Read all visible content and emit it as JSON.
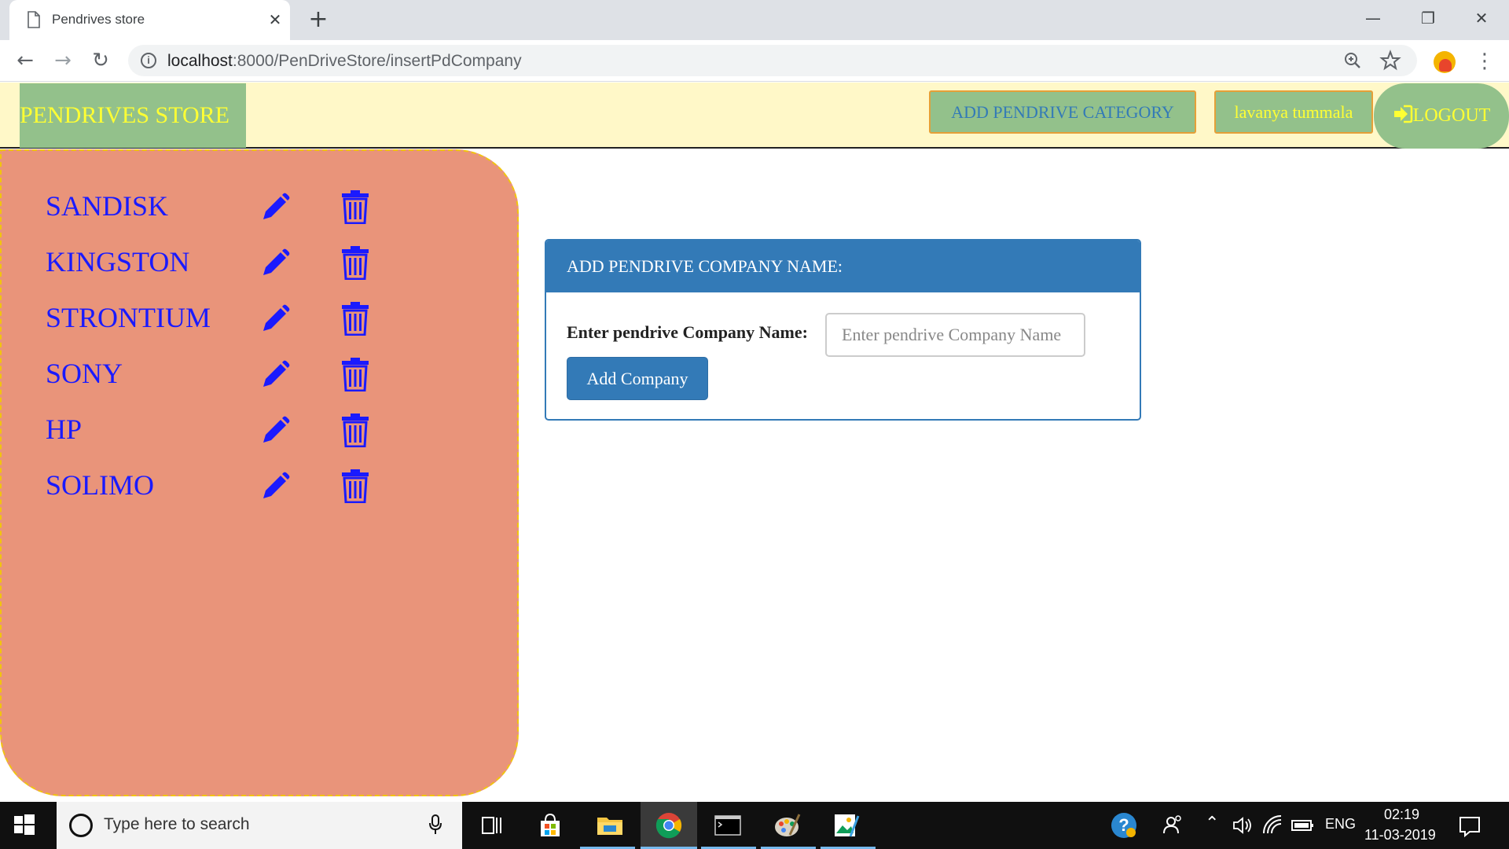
{
  "browser": {
    "tab_title": "Pendrives store",
    "tab_close": "✕",
    "new_tab": "+",
    "url_host": "localhost",
    "url_path": ":8000/PenDriveStore/insertPdCompany",
    "window_controls": {
      "minimize": "—",
      "restore": "❐",
      "close": "✕"
    },
    "nav": {
      "back": "←",
      "forward": "→",
      "reload": "↻"
    },
    "icons": [
      "document-icon",
      "info-icon",
      "zoom-icon",
      "star-icon",
      "profile-avatar",
      "menu-icon"
    ]
  },
  "header": {
    "brand": "PENDRIVES STORE",
    "add_category": "ADD PENDRIVE CATEGORY",
    "user_name": "lavanya tummala",
    "logout": "LOGOUT"
  },
  "sidebar": {
    "companies": [
      {
        "name": "SANDISK"
      },
      {
        "name": "KINGSTON"
      },
      {
        "name": "STRONTIUM"
      },
      {
        "name": "SONY"
      },
      {
        "name": "HP"
      },
      {
        "name": "SOLIMO"
      }
    ]
  },
  "form": {
    "heading": "ADD PENDRIVE COMPANY NAME:",
    "label": "Enter pendrive Company Name:",
    "input_value": "",
    "input_placeholder": "Enter pendrive Company Name",
    "submit": "Add Company"
  },
  "taskbar": {
    "search_placeholder": "Type here to search",
    "language": "ENG",
    "time": "02:19",
    "date": "11-03-2019"
  },
  "colors": {
    "header_bg": "#fff8c8",
    "brand_bg": "#93c18b",
    "brand_text": "#ffff33",
    "sidebar_bg": "#e9947a",
    "link_blue": "#1a1aff",
    "panel_primary": "#337ab7"
  }
}
